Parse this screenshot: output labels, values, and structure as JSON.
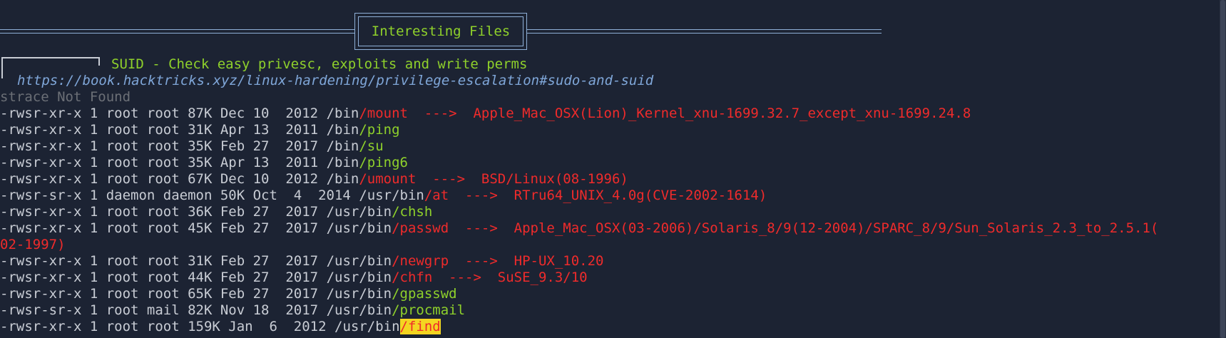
{
  "banner": {
    "title": "Interesting Files"
  },
  "section": {
    "title": "SUID - Check easy privesc, exploits and write perms",
    "link": "https://book.hacktricks.xyz/linux-hardening/privilege-escalation#sudo-and-suid",
    "note": "strace Not Found"
  },
  "entries": [
    {
      "meta": "-rwsr-xr-x 1 root root 87K Dec 10  2012 ",
      "dir": "/bin",
      "name": "/mount",
      "exploit": "  --->  Apple_Mac_OSX(Lion)_Kernel_xnu-1699.32.7_except_xnu-1699.24.8",
      "color": "red"
    },
    {
      "meta": "-rwsr-xr-x 1 root root 31K Apr 13  2011 ",
      "dir": "/bin",
      "name": "/ping",
      "exploit": "",
      "color": "green"
    },
    {
      "meta": "-rwsr-xr-x 1 root root 35K Feb 27  2017 ",
      "dir": "/bin",
      "name": "/su",
      "exploit": "",
      "color": "green"
    },
    {
      "meta": "-rwsr-xr-x 1 root root 35K Apr 13  2011 ",
      "dir": "/bin",
      "name": "/ping6",
      "exploit": "",
      "color": "green"
    },
    {
      "meta": "-rwsr-xr-x 1 root root 67K Dec 10  2012 ",
      "dir": "/bin",
      "name": "/umount",
      "exploit": "  --->  BSD/Linux(08-1996)",
      "color": "red"
    },
    {
      "meta": "-rwsr-sr-x 1 daemon daemon 50K Oct  4  2014 ",
      "dir": "/usr/bin",
      "name": "/at",
      "exploit": "  --->  RTru64_UNIX_4.0g(CVE-2002-1614)",
      "color": "red"
    },
    {
      "meta": "-rwsr-xr-x 1 root root 36K Feb 27  2017 ",
      "dir": "/usr/bin",
      "name": "/chsh",
      "exploit": "",
      "color": "green"
    },
    {
      "meta": "-rwsr-xr-x 1 root root 45K Feb 27  2017 ",
      "dir": "/usr/bin",
      "name": "/passwd",
      "exploit": "  --->  Apple_Mac_OSX(03-2006)/Solaris_8/9(12-2004)/SPARC_8/9/Sun_Solaris_2.3_to_2.5.1(",
      "color": "red"
    },
    {
      "meta": "",
      "dir": "",
      "name": "",
      "exploit": "02-1997)",
      "color": "red"
    },
    {
      "meta": "-rwsr-xr-x 1 root root 31K Feb 27  2017 ",
      "dir": "/usr/bin",
      "name": "/newgrp",
      "exploit": "  --->  HP-UX_10.20",
      "color": "red"
    },
    {
      "meta": "-rwsr-xr-x 1 root root 44K Feb 27  2017 ",
      "dir": "/usr/bin",
      "name": "/chfn",
      "exploit": "  --->  SuSE_9.3/10",
      "color": "red"
    },
    {
      "meta": "-rwsr-xr-x 1 root root 65K Feb 27  2017 ",
      "dir": "/usr/bin",
      "name": "/gpasswd",
      "exploit": "",
      "color": "green"
    },
    {
      "meta": "-rwsr-sr-x 1 root mail 82K Nov 18  2017 ",
      "dir": "/usr/bin",
      "name": "/procmail",
      "exploit": "",
      "color": "green"
    },
    {
      "meta": "-rwsr-xr-x 1 root root 159K Jan  6  2012 ",
      "dir": "/usr/bin",
      "name": "/find",
      "exploit": "",
      "color": "highlight"
    }
  ],
  "colors": {
    "background": "#1c2333",
    "text": "#c8ccd4",
    "danger": "#ef2b2b",
    "safe": "#8fd12b",
    "highlight": "#f4d521",
    "link": "#7fa6d8",
    "rule": "#8fb0d8"
  }
}
